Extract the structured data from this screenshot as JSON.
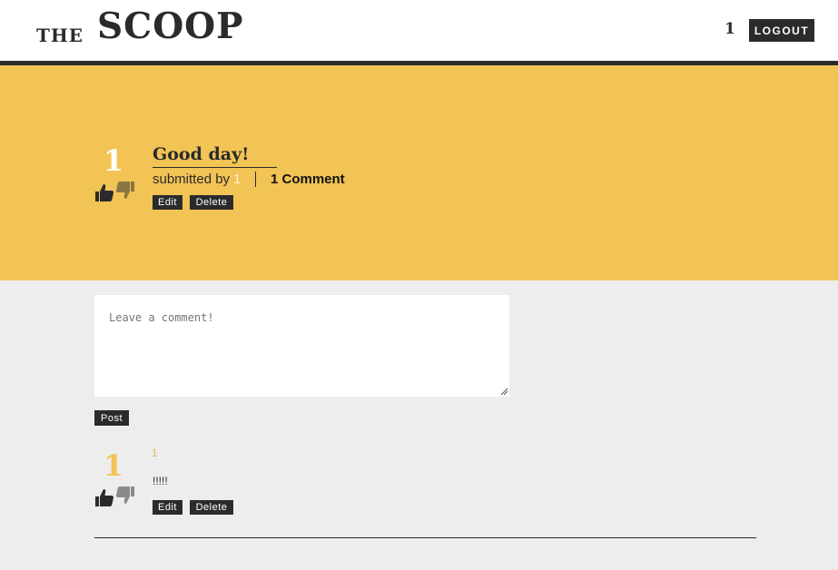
{
  "header": {
    "logo_the": "THE",
    "logo_scoop": "SCOOP",
    "username": "1",
    "logout_label": "LOGOUT"
  },
  "article": {
    "score": "1",
    "title": "Good day!",
    "submitted_prefix": "submitted by",
    "author": "1",
    "comment_count": "1 Comment",
    "edit_label": "Edit",
    "delete_label": "Delete"
  },
  "comment_form": {
    "placeholder": "Leave a comment!",
    "value": "",
    "post_label": "Post"
  },
  "comments": [
    {
      "score": "1",
      "author": "1",
      "text": "!!!!!",
      "edit_label": "Edit",
      "delete_label": "Delete"
    }
  ],
  "colors": {
    "accent": "#f2c355",
    "dark": "#2b2b2b",
    "background": "#ededed"
  },
  "icons": {
    "upvote": "thumbs-up-icon",
    "downvote": "thumbs-down-icon"
  }
}
